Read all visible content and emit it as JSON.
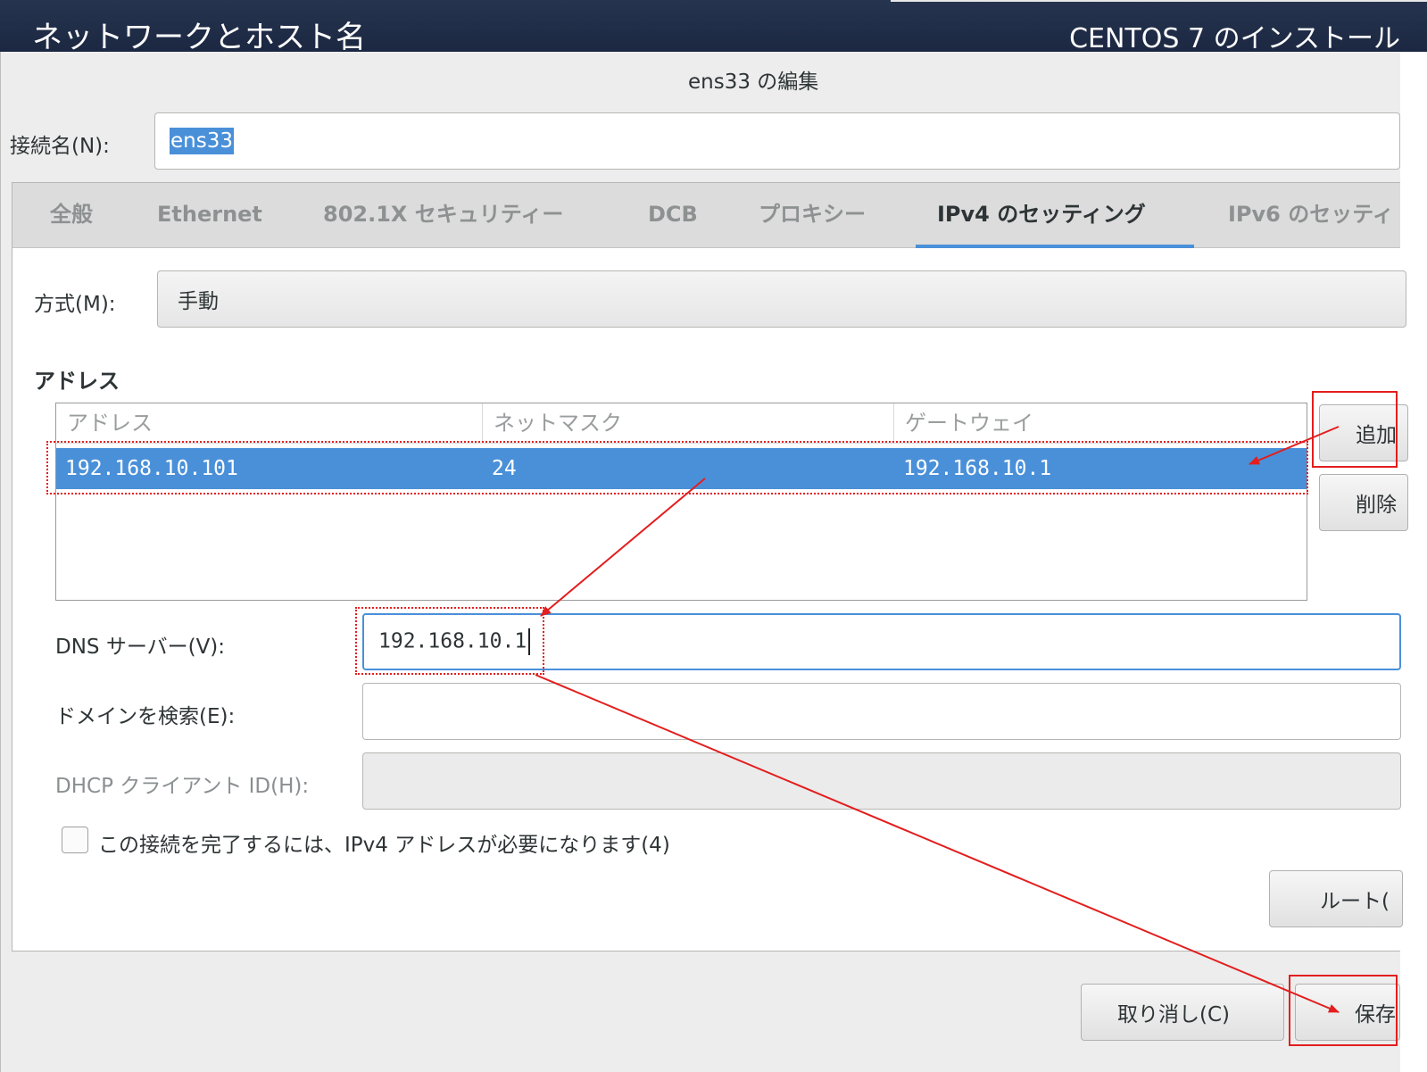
{
  "topbar": {
    "left_title": "ネットワークとホスト名",
    "right_title": "CENTOS 7 のインストール"
  },
  "dialog": {
    "title": "ens33 の編集",
    "connection_name_label": "接続名(N):",
    "connection_name_value": "ens33",
    "tabs": [
      {
        "label": "全般"
      },
      {
        "label": "Ethernet"
      },
      {
        "label": "802.1X セキュリティー"
      },
      {
        "label": "DCB"
      },
      {
        "label": "プロキシー"
      },
      {
        "label": "IPv4 のセッティング"
      },
      {
        "label": "IPv6 のセッティ"
      }
    ],
    "active_tab": "IPv4 のセッティング",
    "method_label": "方式(M):",
    "method_value": "手動",
    "address_section_label": "アドレス",
    "address_table": {
      "columns": [
        "アドレス",
        "ネットマスク",
        "ゲートウェイ"
      ],
      "rows": [
        {
          "address": "192.168.10.101",
          "netmask": "24",
          "gateway": "192.168.10.1"
        }
      ]
    },
    "add_button": "追加",
    "delete_button": "削除",
    "dns_label": "DNS サーバー(V):",
    "dns_value": "192.168.10.1",
    "domain_label": "ドメインを検索(E):",
    "domain_value": "",
    "dhcp_label": "DHCP クライアント ID(H):",
    "dhcp_value": "",
    "require_ipv4_label": "この接続を完了するには、IPv4 アドレスが必要になります(4)",
    "require_ipv4_checked": false,
    "routes_button": "ルート(",
    "cancel_button": "取り消し(C)",
    "save_button": "保存"
  },
  "colors": {
    "accent": "#4a90d9",
    "annotation": "#e31e1e",
    "topbar": "#1c2842"
  }
}
